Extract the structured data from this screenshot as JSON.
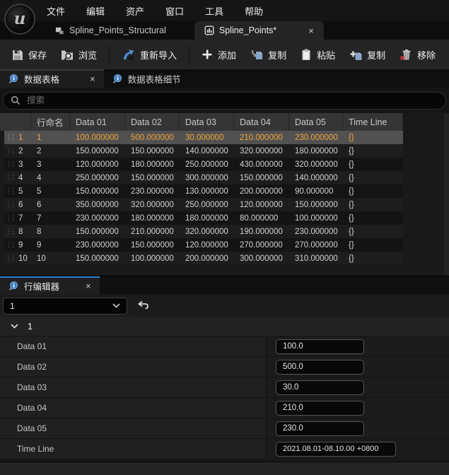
{
  "menu": {
    "items": [
      "文件",
      "编辑",
      "资产",
      "窗口",
      "工具",
      "帮助"
    ]
  },
  "asset_tabs": [
    {
      "label": "Spline_Points_Structural"
    },
    {
      "label": "Spline_Points*"
    }
  ],
  "toolbar": {
    "buttons": [
      {
        "icon": "save-icon",
        "label": "保存"
      },
      {
        "icon": "browse-icon",
        "label": "浏览"
      },
      {
        "icon": "reimport-icon",
        "label": "重新导入"
      },
      {
        "icon": "add-icon",
        "label": "添加"
      },
      {
        "icon": "copy-icon",
        "label": "复制"
      },
      {
        "icon": "paste-icon",
        "label": "粘贴"
      },
      {
        "icon": "duplicate-icon",
        "label": "复制"
      },
      {
        "icon": "remove-icon",
        "label": "移除"
      }
    ]
  },
  "panel_tabs": {
    "data_table": "数据表格",
    "data_table_details": "数据表格细节"
  },
  "search": {
    "placeholder": "搜索"
  },
  "table": {
    "columns": [
      "行命名",
      "Data 01",
      "Data 02",
      "Data 03",
      "Data 04",
      "Data 05",
      "Time Line"
    ],
    "rows": [
      {
        "index": "1",
        "name": "1",
        "values": [
          "100.000000",
          "500.000000",
          "30.000000",
          "210.000000",
          "230.000000"
        ],
        "timeline": "{}",
        "selected": true
      },
      {
        "index": "2",
        "name": "2",
        "values": [
          "150.000000",
          "150.000000",
          "140.000000",
          "320.000000",
          "180.000000"
        ],
        "timeline": "{}",
        "selected": false
      },
      {
        "index": "3",
        "name": "3",
        "values": [
          "120.000000",
          "180.000000",
          "250.000000",
          "430.000000",
          "320.000000"
        ],
        "timeline": "{}",
        "selected": false
      },
      {
        "index": "4",
        "name": "4",
        "values": [
          "250.000000",
          "150.000000",
          "300.000000",
          "150.000000",
          "140.000000"
        ],
        "timeline": "{}",
        "selected": false
      },
      {
        "index": "5",
        "name": "5",
        "values": [
          "150.000000",
          "230.000000",
          "130.000000",
          "200.000000",
          "90.000000"
        ],
        "timeline": "{}",
        "selected": false
      },
      {
        "index": "6",
        "name": "6",
        "values": [
          "350.000000",
          "320.000000",
          "250.000000",
          "120.000000",
          "150.000000"
        ],
        "timeline": "{}",
        "selected": false
      },
      {
        "index": "7",
        "name": "7",
        "values": [
          "230.000000",
          "180.000000",
          "180.000000",
          "80.000000",
          "100.000000"
        ],
        "timeline": "{}",
        "selected": false
      },
      {
        "index": "8",
        "name": "8",
        "values": [
          "150.000000",
          "210.000000",
          "320.000000",
          "190.000000",
          "230.000000"
        ],
        "timeline": "{}",
        "selected": false
      },
      {
        "index": "9",
        "name": "9",
        "values": [
          "230.000000",
          "150.000000",
          "120.000000",
          "270.000000",
          "270.000000"
        ],
        "timeline": "{}",
        "selected": false
      },
      {
        "index": "10",
        "name": "10",
        "values": [
          "150.000000",
          "100.000000",
          "200.000000",
          "300.000000",
          "310.000000"
        ],
        "timeline": "{}",
        "selected": false
      }
    ]
  },
  "row_editor": {
    "tab": "行编辑器",
    "selected_row": "1",
    "section_label": "1",
    "fields": [
      {
        "label": "Data 01",
        "value": "100.0"
      },
      {
        "label": "Data 02",
        "value": "500.0"
      },
      {
        "label": "Data 03",
        "value": "30.0"
      },
      {
        "label": "Data 04",
        "value": "210.0"
      },
      {
        "label": "Data 05",
        "value": "230.0"
      },
      {
        "label": "Time Line",
        "value": "2021.08.01-08.10.00 +0800"
      }
    ]
  },
  "glyphs": {
    "close": "×"
  },
  "colors": {
    "accent_blue": "#2f7cd6",
    "selection_orange": "#f0a63c",
    "selected_row_bg": "#515151"
  }
}
